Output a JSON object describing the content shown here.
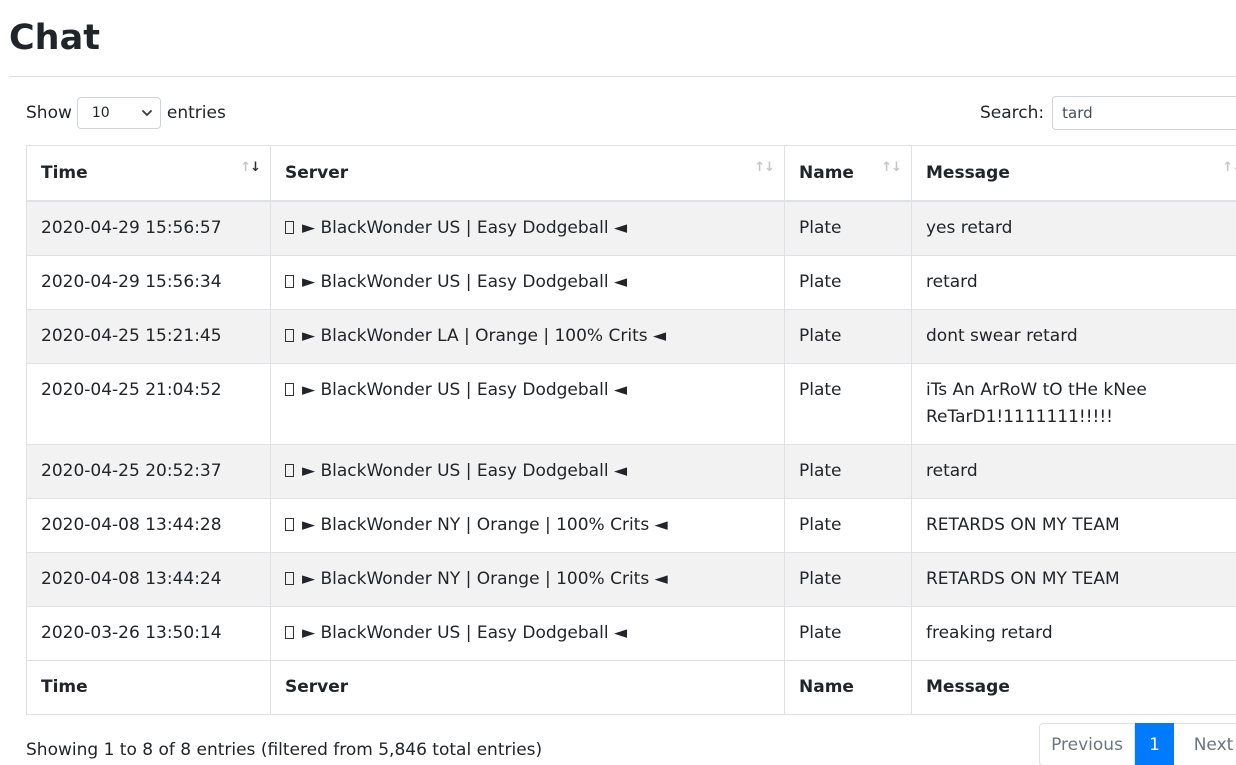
{
  "page": {
    "title": "Chat"
  },
  "length": {
    "show_label": "Show",
    "value": "10",
    "entries_label": "entries"
  },
  "search": {
    "label": "Search:",
    "value": "tard"
  },
  "table": {
    "headers": {
      "time": "Time",
      "server": "Server",
      "name": "Name",
      "message": "Message"
    },
    "rows": [
      {
        "time": "2020-04-29 15:56:57",
        "server": "► BlackWonder US | Easy Dodgeball ◄",
        "name": "Plate",
        "message": "yes retard"
      },
      {
        "time": "2020-04-29 15:56:34",
        "server": "► BlackWonder US | Easy Dodgeball ◄",
        "name": "Plate",
        "message": "retard"
      },
      {
        "time": "2020-04-25 15:21:45",
        "server": "► BlackWonder LA | Orange | 100% Crits ◄",
        "name": "Plate",
        "message": "dont swear retard"
      },
      {
        "time": "2020-04-25 21:04:52",
        "server": "► BlackWonder US | Easy Dodgeball ◄",
        "name": "Plate",
        "message": "iTs An ArRoW tO tHe kNee ReTarD1!1111111!!!!!"
      },
      {
        "time": "2020-04-25 20:52:37",
        "server": "► BlackWonder US | Easy Dodgeball ◄",
        "name": "Plate",
        "message": "retard"
      },
      {
        "time": "2020-04-08 13:44:28",
        "server": "► BlackWonder NY | Orange | 100% Crits ◄",
        "name": "Plate",
        "message": "RETARDS ON MY TEAM"
      },
      {
        "time": "2020-04-08 13:44:24",
        "server": "► BlackWonder NY | Orange | 100% Crits ◄",
        "name": "Plate",
        "message": "RETARDS ON MY TEAM"
      },
      {
        "time": "2020-03-26 13:50:14",
        "server": "► BlackWonder US | Easy Dodgeball ◄",
        "name": "Plate",
        "message": "freaking retard"
      }
    ]
  },
  "info": {
    "text": "Showing 1 to 8 of 8 entries (filtered from 5,846 total entries)"
  },
  "pagination": {
    "previous": "Previous",
    "current": "1",
    "next": "Next"
  },
  "colors": {
    "accent": "#007bff",
    "stripe": "#f2f2f2",
    "border": "#dee2e6"
  },
  "icons": {
    "server_prefix": "missing-glyph-icon",
    "sort": "sort-arrows-icon",
    "select": "chevron-down-icon"
  }
}
